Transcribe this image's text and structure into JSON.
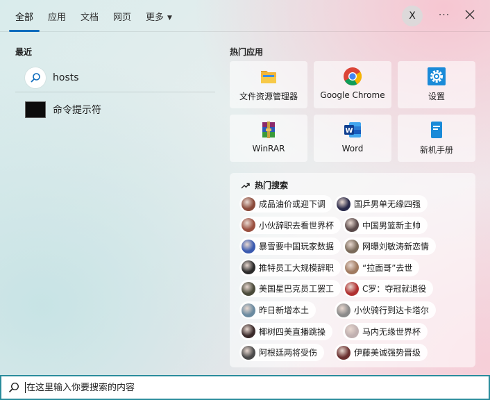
{
  "tabs": [
    {
      "label": "全部"
    },
    {
      "label": "应用"
    },
    {
      "label": "文档"
    },
    {
      "label": "网页"
    },
    {
      "label": "更多"
    }
  ],
  "account": {
    "initial": "X"
  },
  "recent": {
    "title": "最近",
    "items": [
      {
        "label": "hosts",
        "icon": "search-icon"
      },
      {
        "label": "命令提示符",
        "icon": "command-prompt-icon"
      }
    ]
  },
  "hot_apps": {
    "title": "热门应用",
    "items": [
      {
        "label": "文件资源管理器",
        "icon": "file-explorer-icon"
      },
      {
        "label": "Google Chrome",
        "icon": "chrome-icon"
      },
      {
        "label": "设置",
        "icon": "settings-gear-icon"
      },
      {
        "label": "WinRAR",
        "icon": "winrar-icon"
      },
      {
        "label": "Word",
        "icon": "word-icon"
      },
      {
        "label": "新机手册",
        "icon": "manual-icon"
      }
    ]
  },
  "hot_search": {
    "title": "热门搜索",
    "items": [
      {
        "label": "成品油价或迎下调",
        "thumb": "#8a4a3a"
      },
      {
        "label": "国乒男单无缘四强",
        "thumb": "#2a2a4a"
      },
      {
        "label": "小伙辞职去看世界杯",
        "thumb": "#9a5040"
      },
      {
        "label": "中国男篮新主帅",
        "thumb": "#5a4a4a"
      },
      {
        "label": "暴雪要中国玩家数据",
        "thumb": "#3a5ab0"
      },
      {
        "label": "网曝刘敏涛新恋情",
        "thumb": "#7a6a5a"
      },
      {
        "label": "推特员工大规模辞职",
        "thumb": "#2a2a2a"
      },
      {
        "label": "“拉面哥”去世",
        "thumb": "#a07a60"
      },
      {
        "label": "美国星巴克员工罢工",
        "thumb": "#4a4a3a"
      },
      {
        "label": "C罗：夺冠就退役",
        "thumb": "#b03030"
      },
      {
        "label": "昨日新增本土",
        "thumb": "#6a8aa0"
      },
      {
        "label": "小伙骑行到达卡塔尔",
        "thumb": "#8a8a8a"
      },
      {
        "label": "椰树四美直播跳操",
        "thumb": "#3a2a2a"
      },
      {
        "label": "马内无缘世界杯",
        "thumb": "#c0b0b0"
      },
      {
        "label": "阿根廷两将受伤",
        "thumb": "#4a4a4a"
      },
      {
        "label": "伊藤美诚强势晋级",
        "thumb": "#6a3030"
      }
    ]
  },
  "search": {
    "placeholder": "在这里输入你要搜索的内容",
    "value": ""
  },
  "colors": {
    "accent": "#0f6cbd",
    "search_border": "#2a8c9c"
  }
}
